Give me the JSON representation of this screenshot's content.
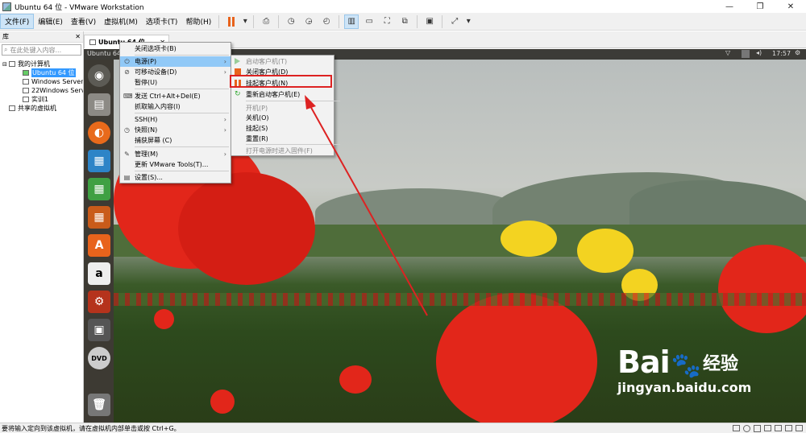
{
  "window": {
    "title": "Ubuntu 64 位 - VMware Workstation",
    "minimize": "—",
    "maximize": "❐",
    "close": "✕"
  },
  "menubar": {
    "items": [
      "文件(F)",
      "编辑(E)",
      "查看(V)",
      "虚拟机(M)",
      "选项卡(T)",
      "帮助(H)"
    ]
  },
  "library": {
    "title": "库",
    "close": "✕",
    "search_placeholder": "在此处键入内容...",
    "tree": [
      {
        "label": "我的计算机",
        "level": 0
      },
      {
        "label": "Ubuntu 64 位",
        "level": 1,
        "selected": true
      },
      {
        "label": "Windows Server",
        "level": 1
      },
      {
        "label": "22Windows Server",
        "level": 1
      },
      {
        "label": "实训1",
        "level": 1
      },
      {
        "label": "共享的虚拟机",
        "level": 0
      }
    ]
  },
  "vm_tab": {
    "label": "Ubuntu 64 位",
    "close": "✕"
  },
  "guest": {
    "topbar_title": "Ubuntu 64",
    "clock": "17:57"
  },
  "context_menu": {
    "items": [
      {
        "label": "关闭选项卡(B)"
      },
      {
        "label": "电源(P)",
        "submenu": true,
        "highlighted": true
      },
      {
        "label": "可移动设备(D)",
        "submenu": true
      },
      {
        "label": "暂停(U)"
      },
      {
        "label": "发送 Ctrl+Alt+Del(E)"
      },
      {
        "label": "抓取输入内容(I)"
      },
      {
        "label": "SSH(H)",
        "submenu": true
      },
      {
        "label": "快照(N)",
        "submenu": true
      },
      {
        "label": "捕获屏幕 (C)"
      },
      {
        "label": "管理(M)",
        "submenu": true
      },
      {
        "label": "更新 VMware Tools(T)..."
      },
      {
        "label": "设置(S)..."
      }
    ]
  },
  "power_submenu": {
    "items": [
      {
        "label": "启动客户机(T)",
        "disabled": true
      },
      {
        "label": "关闭客户机(D)"
      },
      {
        "label": "挂起客户机(N)",
        "boxed": true
      },
      {
        "label": "重新启动客户机(E)"
      },
      {
        "label": "开机(P)",
        "disabled": true
      },
      {
        "label": "关机(O)"
      },
      {
        "label": "挂起(S)"
      },
      {
        "label": "重置(R)"
      },
      {
        "label": "打开电源时进入固件(F)",
        "disabled": true
      }
    ]
  },
  "statusbar": {
    "text": "要将输入定向到该虚拟机，请在虚拟机内部单击或按 Ctrl+G。"
  },
  "watermark": {
    "brand": "Bai",
    "suffix": "经验",
    "url": "jingyan.baidu.com"
  },
  "colors": {
    "accent": "#3399ff",
    "highlight": "#91c9f7",
    "callout": "#dd2222",
    "ubuntu_launcher": "#3d3a33"
  }
}
